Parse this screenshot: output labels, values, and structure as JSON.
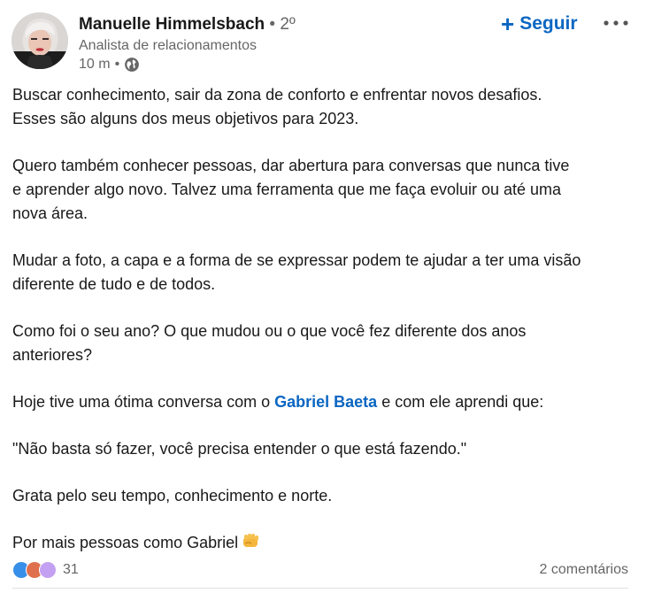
{
  "author": {
    "name": "Manuelle Himmelsbach",
    "degree_sep": " • ",
    "degree": "2º",
    "headline": "Analista de relacionamentos",
    "time": "10 m",
    "meta_sep": "•"
  },
  "actions": {
    "follow_icon": "+",
    "follow_label": "Seguir",
    "more_icon": "more-horizontal-icon"
  },
  "post": {
    "p1_line1": "Buscar conhecimento, sair da zona de conforto e enfrentar novos desafios.",
    "p1_line2": "Esses são alguns dos meus objetivos para 2023.",
    "p2_line1": "Quero também conhecer pessoas, dar abertura para conversas que nunca tive",
    "p2_line2": "e aprender algo novo. Talvez uma ferramenta que me faça evoluir ou até uma",
    "p2_line3": "nova área.",
    "p3_line1": "Mudar a foto, a capa e a forma de se expressar podem te ajudar a ter uma visão",
    "p3_line2": "diferente de tudo e de todos.",
    "p4_line1": "Como foi o seu ano? O que mudou ou o que você fez diferente dos anos",
    "p4_line2": "anteriores?",
    "p5_before": "Hoje tive uma ótima conversa com o ",
    "p5_mention": "Gabriel Baeta",
    "p5_after": " e com ele aprendi que:",
    "p6": "\"Não basta só fazer, você precisa entender o que está fazendo.\"",
    "p7": "Grata pelo seu tempo, conhecimento e norte.",
    "p8": "Por mais pessoas como Gabriel"
  },
  "social": {
    "reaction_count": "31",
    "comments": "2 comentários"
  },
  "colors": {
    "link": "#0a66c2",
    "muted": "#666666",
    "like": "#378fe9",
    "love": "#df704d",
    "support": "#c3a0f2"
  }
}
